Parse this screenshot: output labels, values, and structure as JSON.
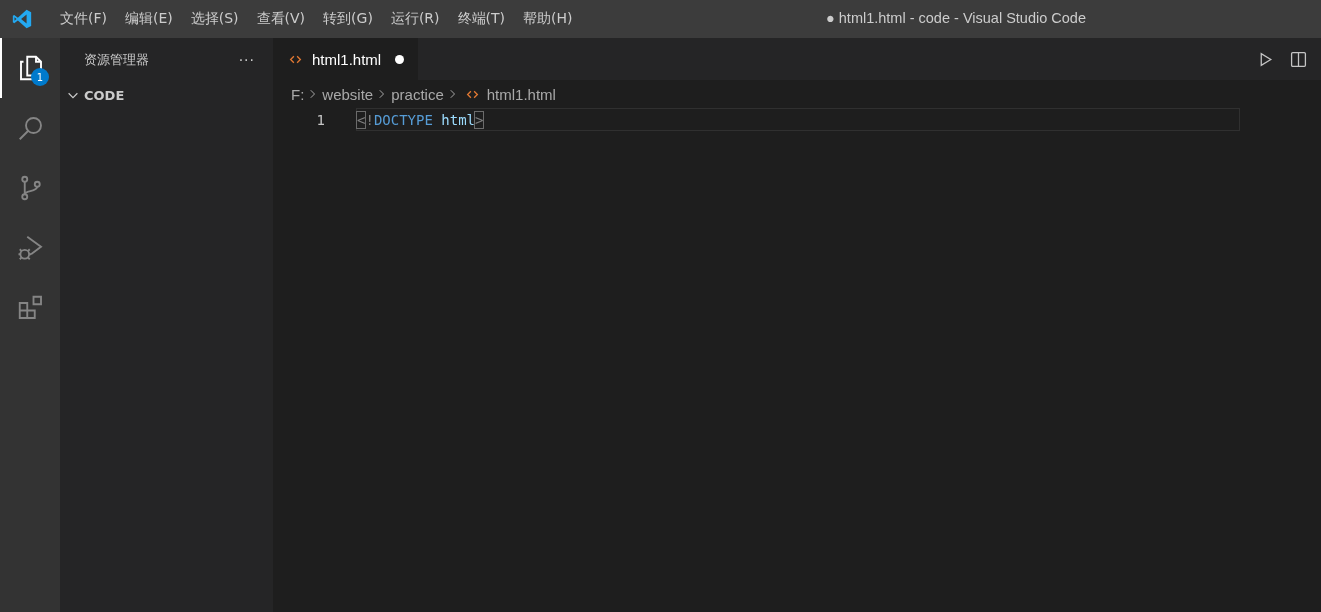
{
  "window": {
    "title": "● html1.html - code - Visual Studio Code"
  },
  "menu": [
    "文件(F)",
    "编辑(E)",
    "选择(S)",
    "查看(V)",
    "转到(G)",
    "运行(R)",
    "终端(T)",
    "帮助(H)"
  ],
  "activity_bar": [
    {
      "kind": "explorer",
      "selected": true,
      "badge": "1"
    },
    {
      "kind": "search",
      "selected": false
    },
    {
      "kind": "source-control",
      "selected": false
    },
    {
      "kind": "run-debug",
      "selected": false
    },
    {
      "kind": "extensions",
      "selected": false
    }
  ],
  "sidebar": {
    "title": "资源管理器",
    "more": "···",
    "folder": {
      "label": "CODE",
      "expanded": true
    }
  },
  "tabs": [
    {
      "label": "html1.html",
      "selected": true,
      "modified": true
    }
  ],
  "breadcrumbs": [
    {
      "label": "F:",
      "kind": "folder"
    },
    {
      "label": "website",
      "kind": "folder"
    },
    {
      "label": "practice",
      "kind": "folder"
    },
    {
      "label": "html1.html",
      "kind": "file"
    }
  ],
  "code": [
    {
      "number": "1",
      "current": true,
      "tokens": [
        {
          "text": "<",
          "kind": "bracket-match"
        },
        {
          "text": "!",
          "kind": "punct"
        },
        {
          "text": "DOCTYPE ",
          "kind": "keyword"
        },
        {
          "text": "html",
          "kind": "name"
        },
        {
          "text": ">",
          "kind": "bracket-match"
        }
      ]
    }
  ]
}
